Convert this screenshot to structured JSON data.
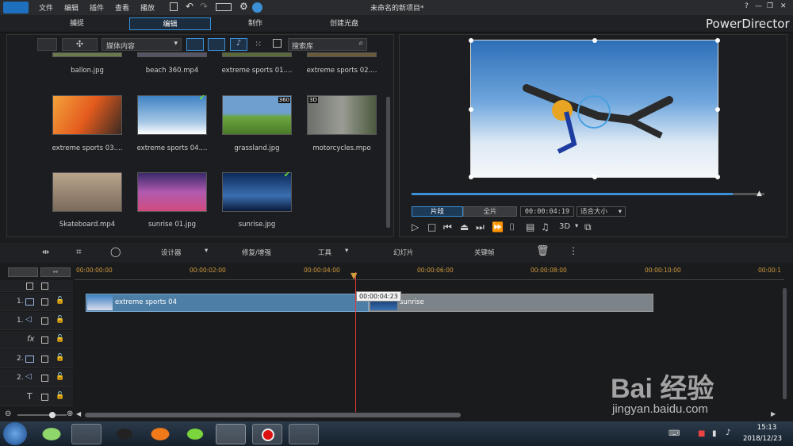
{
  "title_bar": {
    "menus": [
      "文件",
      "编辑",
      "插件",
      "查看",
      "播放"
    ],
    "project_title": "未命名的新项目*",
    "app_name": "PowerDirector",
    "window_buttons": [
      "?",
      "—",
      "❐",
      "✕"
    ]
  },
  "mode_tabs": [
    "捕捉",
    "编辑",
    "制作",
    "创建光盘"
  ],
  "library": {
    "dropdown": "媒体内容",
    "search_placeholder": "搜索库",
    "items": [
      {
        "name": "ballon.jpg"
      },
      {
        "name": "beach 360.mp4"
      },
      {
        "name": "extreme sports 01...."
      },
      {
        "name": "extreme sports 02...."
      },
      {
        "name": "extreme sports 03...."
      },
      {
        "name": "extreme sports 04...."
      },
      {
        "name": "grassland.jpg",
        "badge": "360"
      },
      {
        "name": "motorcycles.mpo",
        "badge": "3D"
      },
      {
        "name": "Skateboard.mp4"
      },
      {
        "name": "sunrise 01.jpg"
      },
      {
        "name": "sunrise.jpg"
      }
    ]
  },
  "preview": {
    "seg_clip": "片段",
    "seg_full": "全片",
    "timecode": "00:00:04:19",
    "fit": "适合大小",
    "threed": "3D",
    "progress": 0.91
  },
  "toolbar": {
    "designer": "设计器",
    "fix": "修复/增强",
    "tools": "工具",
    "slideshow": "幻灯片",
    "keyframe": "关键帧"
  },
  "timeline": {
    "ruler": [
      "00:00:00:00",
      "00:00:02:00",
      "00:00:04:00",
      "00:00:06:00",
      "00:00:08:00",
      "00:00:10:00",
      "00:00:1"
    ],
    "tracks": [
      "1.",
      "1.",
      "",
      "2.",
      "2.",
      ""
    ],
    "clips": {
      "clip1": "extreme sports 04",
      "clip2": "sunrise"
    },
    "tooltip": "00:00:04:23"
  },
  "taskbar": {
    "time": "15:13",
    "date": "2018/12/23"
  },
  "watermark": {
    "brand": "Bai 经验",
    "url": "jingyan.baidu.com"
  },
  "colors": {
    "accent": "#3a8fd6",
    "clip_video": "#4d7ea6",
    "clip_gray": "#7c8389",
    "playhead": "#e23c3c"
  }
}
